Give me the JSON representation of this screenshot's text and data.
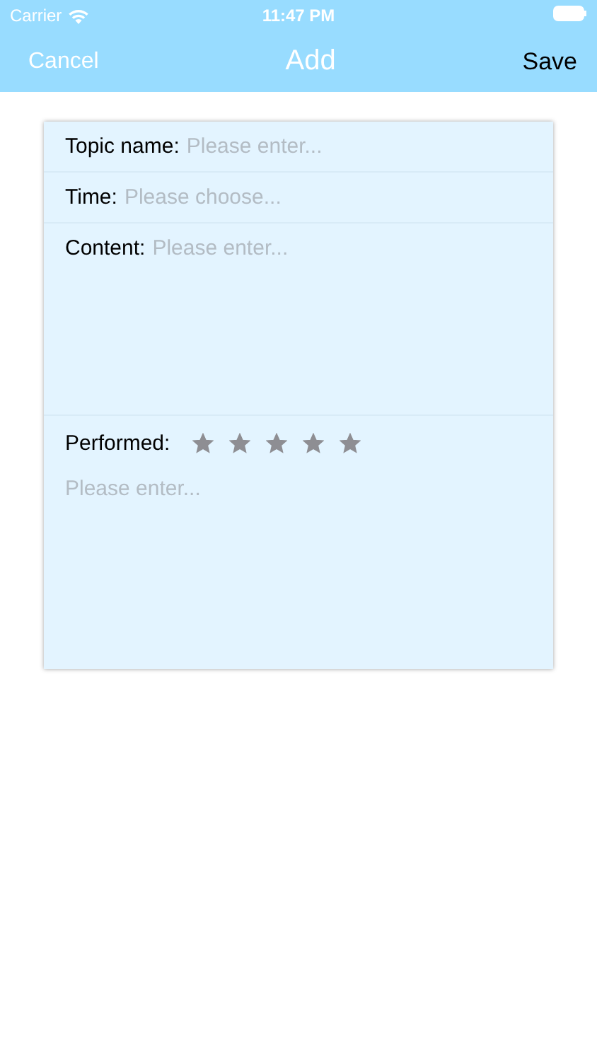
{
  "status_bar": {
    "carrier": "Carrier",
    "time": "11:47 PM"
  },
  "nav": {
    "cancel": "Cancel",
    "title": "Add",
    "save": "Save"
  },
  "form": {
    "fields": [
      {
        "label": "Topic name:",
        "placeholder": "Please enter...",
        "kind": "line"
      },
      {
        "label": "Time:",
        "placeholder": "Please choose...",
        "kind": "line"
      },
      {
        "label": "Content:",
        "placeholder": "Please enter...",
        "kind": "area"
      }
    ],
    "performed": {
      "label": "Performed:",
      "stars": 5
    },
    "notes": {
      "placeholder": "Please enter..."
    }
  }
}
